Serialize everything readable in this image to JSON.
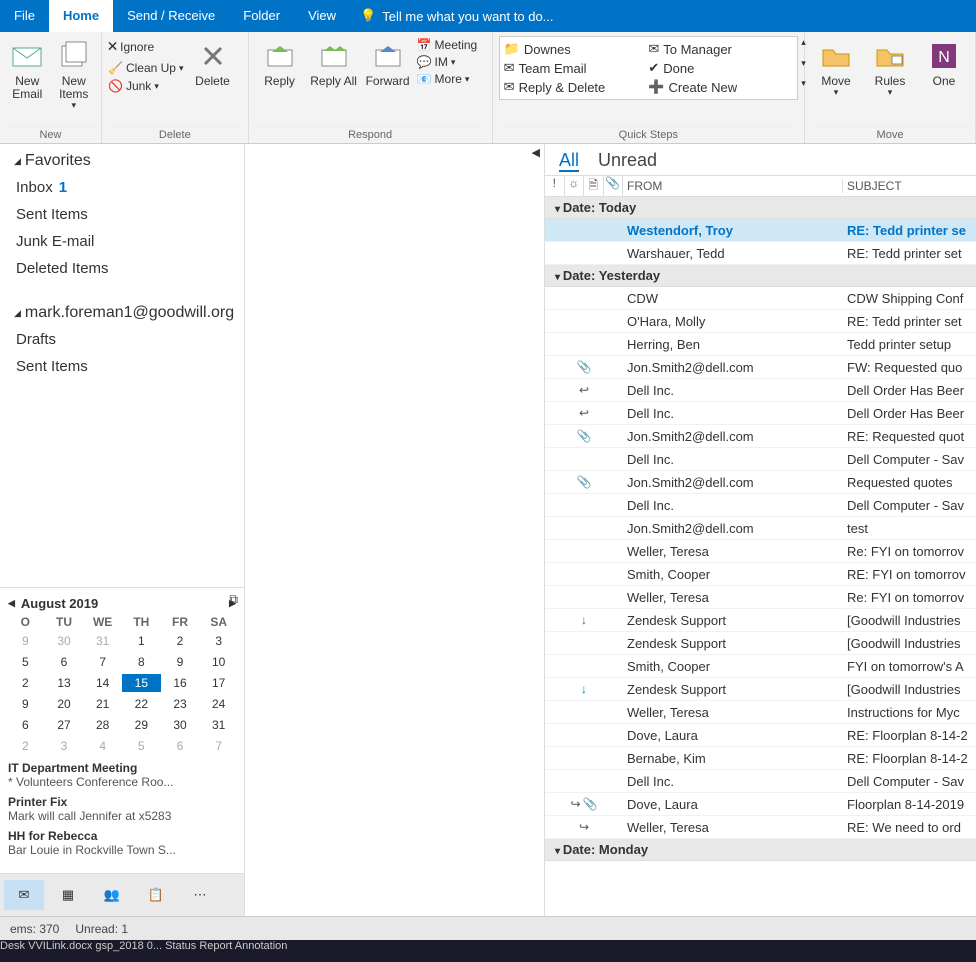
{
  "tabs": {
    "file": "File",
    "home": "Home",
    "sendreceive": "Send / Receive",
    "folder": "Folder",
    "view": "View",
    "tell": "Tell me what you want to do..."
  },
  "ribbon": {
    "new_email": "New Email",
    "new_items": "New Items",
    "new_group": "New",
    "ignore": "Ignore",
    "cleanup": "Clean Up",
    "junk": "Junk",
    "delete": "Delete",
    "delete_group": "Delete",
    "reply": "Reply",
    "reply_all": "Reply All",
    "forward": "Forward",
    "meeting": "Meeting",
    "im": "IM",
    "more": "More",
    "respond_group": "Respond",
    "qs": {
      "downes": "Downes",
      "team_email": "Team Email",
      "reply_delete": "Reply & Delete",
      "to_manager": "To Manager",
      "done": "Done",
      "create_new": "Create New"
    },
    "qs_group": "Quick Steps",
    "move": "Move",
    "rules": "Rules",
    "one": "One",
    "move_group": "Move"
  },
  "nav": {
    "favorites": "Favorites",
    "inbox": "Inbox",
    "inbox_count": "1",
    "sent": "Sent Items",
    "junk": "Junk E-mail",
    "deleted": "Deleted Items",
    "account": "mark.foreman1@goodwill.org",
    "drafts": "Drafts",
    "sent2": "Sent Items"
  },
  "calendar": {
    "month": "August 2019",
    "headers": [
      "O",
      "TU",
      "WE",
      "TH",
      "FR",
      "SA"
    ],
    "rows": [
      [
        "9",
        "30",
        "31",
        "1",
        "2",
        "3"
      ],
      [
        "5",
        "6",
        "7",
        "8",
        "9",
        "10"
      ],
      [
        "2",
        "13",
        "14",
        "15",
        "16",
        "17"
      ],
      [
        "9",
        "20",
        "21",
        "22",
        "23",
        "24"
      ],
      [
        "6",
        "27",
        "28",
        "29",
        "30",
        "31"
      ],
      [
        "2",
        "3",
        "4",
        "5",
        "6",
        "7"
      ]
    ],
    "selected": "15",
    "events": [
      {
        "title": "IT Department Meeting",
        "sub": "* Volunteers Conference Roo..."
      },
      {
        "title": "Printer Fix",
        "sub": "Mark will call Jennifer at x5283"
      },
      {
        "title": "HH for Rebecca",
        "sub": "Bar Louie in Rockville Town S..."
      }
    ]
  },
  "list": {
    "tabs": {
      "all": "All",
      "unread": "Unread"
    },
    "headers": {
      "from": "FROM",
      "subject": "SUBJECT"
    },
    "groups": [
      {
        "label": "Date: Today",
        "msgs": [
          {
            "from": "Westendorf, Troy",
            "subject": "RE: Tedd printer se",
            "unread": true,
            "selected": true
          },
          {
            "from": "Warshauer, Tedd",
            "subject": "RE: Tedd printer set"
          }
        ]
      },
      {
        "label": "Date: Yesterday",
        "msgs": [
          {
            "from": "CDW",
            "subject": "CDW Shipping Conf"
          },
          {
            "from": "O'Hara, Molly",
            "subject": "RE: Tedd printer set"
          },
          {
            "from": "Herring, Ben",
            "subject": "Tedd printer setup"
          },
          {
            "from": "Jon.Smith2@dell.com",
            "subject": "FW: Requested quo",
            "attach": true
          },
          {
            "from": "Dell Inc.",
            "subject": "Dell Order Has Beer",
            "replied": true
          },
          {
            "from": "Dell Inc.",
            "subject": "Dell Order Has Beer",
            "replied": true
          },
          {
            "from": "Jon.Smith2@dell.com",
            "subject": "RE: Requested quot",
            "attach": true
          },
          {
            "from": "Dell Inc.",
            "subject": "Dell Computer - Sav"
          },
          {
            "from": "Jon.Smith2@dell.com",
            "subject": "Requested quotes",
            "attach": true
          },
          {
            "from": "Dell Inc.",
            "subject": "Dell Computer - Sav"
          },
          {
            "from": "Jon.Smith2@dell.com",
            "subject": "test"
          },
          {
            "from": "Weller, Teresa",
            "subject": "Re: FYI on tomorrov"
          },
          {
            "from": "Smith, Cooper",
            "subject": "RE: FYI on tomorrov"
          },
          {
            "from": "Weller, Teresa",
            "subject": "Re: FYI on tomorrov"
          },
          {
            "from": "Zendesk Support",
            "subject": "[Goodwill Industries",
            "down": true
          },
          {
            "from": "Zendesk Support",
            "subject": "[Goodwill Industries"
          },
          {
            "from": "Smith, Cooper",
            "subject": "FYI on tomorrow's A"
          },
          {
            "from": "Zendesk Support",
            "subject": "[Goodwill Industries",
            "down": true
          },
          {
            "from": "Weller, Teresa",
            "subject": "Instructions for Myc"
          },
          {
            "from": "Dove, Laura",
            "subject": "RE: Floorplan 8-14-2"
          },
          {
            "from": "Bernabe, Kim",
            "subject": "RE: Floorplan 8-14-2"
          },
          {
            "from": "Dell Inc.",
            "subject": "Dell Computer - Sav"
          },
          {
            "from": "Dove, Laura",
            "subject": "Floorplan 8-14-2019",
            "forward": true,
            "attach": true
          },
          {
            "from": "Weller, Teresa",
            "subject": "RE: We need to ord",
            "forward": true
          }
        ]
      },
      {
        "label": "Date: Monday",
        "msgs": []
      }
    ]
  },
  "status": {
    "items": "ems: 370",
    "unread": "Unread: 1"
  },
  "taskbar": "Desk   VVILink.docx  gsp_2018 0...  Status Report   Annotation"
}
